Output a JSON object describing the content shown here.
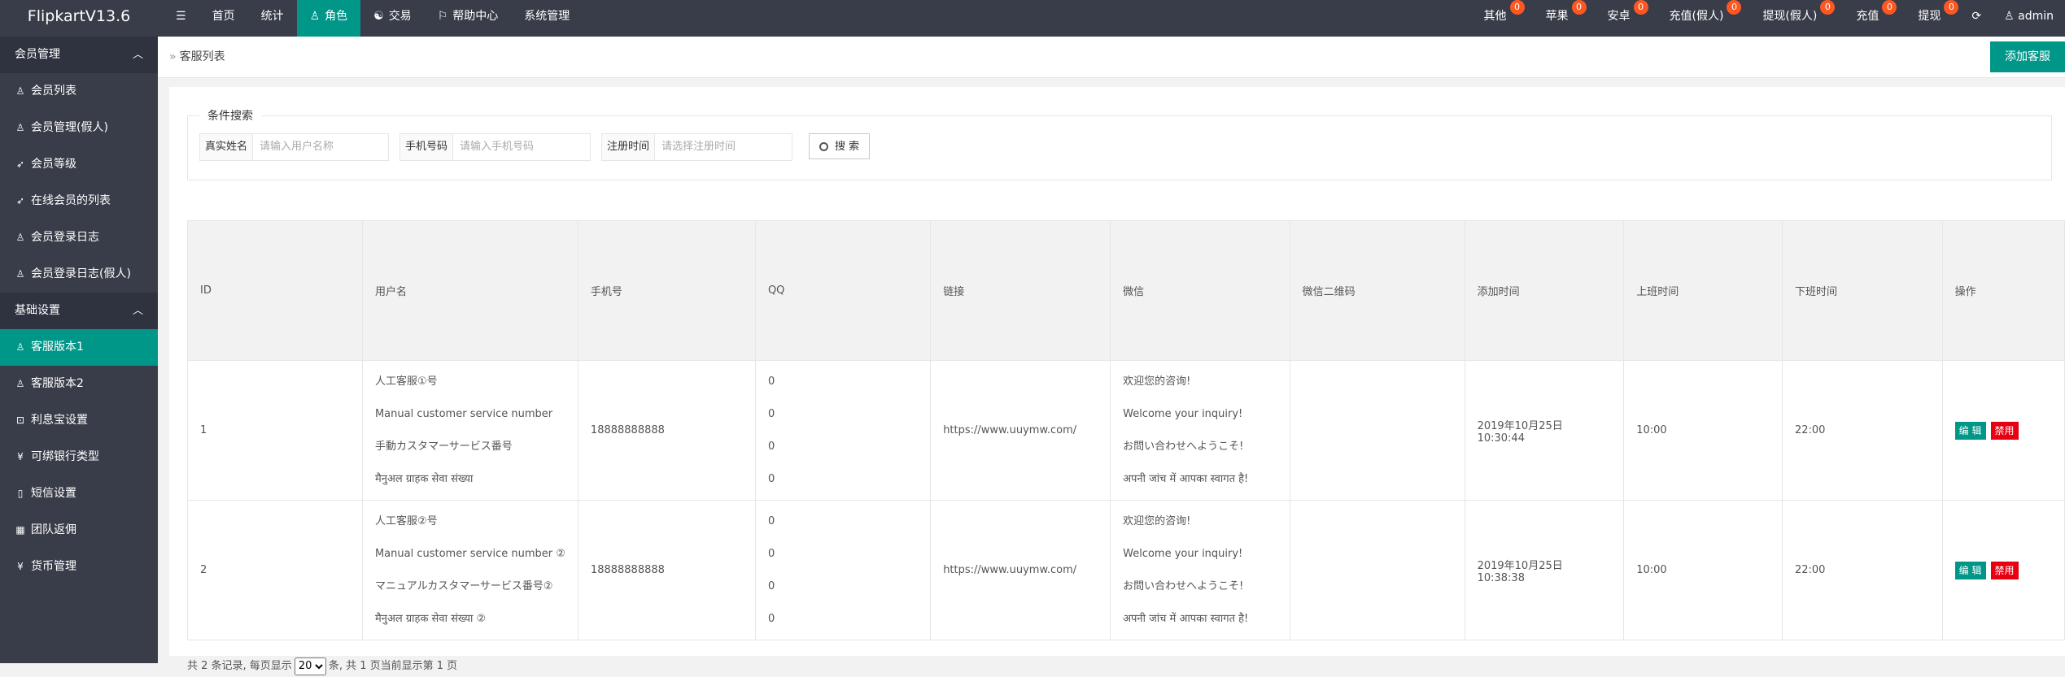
{
  "app": {
    "title": "FlipkartV13.6"
  },
  "topnav": [
    {
      "label": "☰",
      "name": "menu-toggle",
      "icon": ""
    },
    {
      "label": "首页",
      "name": "nav-home",
      "icon": ""
    },
    {
      "label": "统计",
      "name": "nav-stats",
      "icon": ""
    },
    {
      "label": "角色",
      "name": "nav-role",
      "icon": "user-icon",
      "glyph": "♙"
    },
    {
      "label": "交易",
      "name": "nav-trade",
      "icon": "trade-icon",
      "glyph": "☯"
    },
    {
      "label": "帮助中心",
      "name": "nav-help",
      "icon": "flag-icon",
      "glyph": "⚐"
    },
    {
      "label": "系统管理",
      "name": "nav-system",
      "icon": ""
    }
  ],
  "topright": [
    {
      "label": "其他",
      "badge": "0"
    },
    {
      "label": "苹果",
      "badge": "0"
    },
    {
      "label": "安卓",
      "badge": "0"
    },
    {
      "label": "充值(假人)",
      "badge": "0"
    },
    {
      "label": "提现(假人)",
      "badge": "0"
    },
    {
      "label": "充值",
      "badge": "0"
    },
    {
      "label": "提现",
      "badge": "0"
    }
  ],
  "user": {
    "name": "admin"
  },
  "sidebar": {
    "groups": [
      {
        "label": "会员管理",
        "items": [
          {
            "label": "会员列表",
            "icon": "user-icon",
            "glyph": "♙"
          },
          {
            "label": "会员管理(假人)",
            "icon": "user-icon",
            "glyph": "♙"
          },
          {
            "label": "会员等级",
            "icon": "rocket-icon",
            "glyph": "➶"
          },
          {
            "label": "在线会员的列表",
            "icon": "rocket-icon",
            "glyph": "➶"
          },
          {
            "label": "会员登录日志",
            "icon": "user-icon",
            "glyph": "♙"
          },
          {
            "label": "会员登录日志(假人)",
            "icon": "user-icon",
            "glyph": "♙"
          }
        ]
      },
      {
        "label": "基础设置",
        "items": [
          {
            "label": "客服版本1",
            "icon": "user-icon",
            "glyph": "♙",
            "active": true
          },
          {
            "label": "客服版本2",
            "icon": "user-icon",
            "glyph": "♙"
          },
          {
            "label": "利息宝设置",
            "icon": "lock-icon",
            "glyph": "⊡"
          },
          {
            "label": "可绑银行类型",
            "icon": "yen-icon",
            "glyph": "¥"
          },
          {
            "label": "短信设置",
            "icon": "phone-icon",
            "glyph": "▯"
          },
          {
            "label": "团队返佣",
            "icon": "grid-icon",
            "glyph": "▦"
          },
          {
            "label": "货币管理",
            "icon": "yen-icon",
            "glyph": "¥"
          }
        ]
      }
    ]
  },
  "breadcrumb": {
    "label": "客服列表"
  },
  "add_button": {
    "label": "添加客服"
  },
  "search": {
    "legend": "条件搜索",
    "fields": [
      {
        "label": "真实姓名",
        "placeholder": "请输入用户名称"
      },
      {
        "label": "手机号码",
        "placeholder": "请输入手机号码"
      },
      {
        "label": "注册时间",
        "placeholder": "请选择注册时间"
      }
    ],
    "button": "搜 索"
  },
  "table": {
    "headers": [
      "ID",
      "用户名",
      "手机号",
      "QQ",
      "链接",
      "微信",
      "微信二维码",
      "添加时间",
      "上班时间",
      "下班时间",
      "操作"
    ],
    "rows": [
      {
        "id": "1",
        "names": [
          "人工客服①号",
          "Manual customer service number",
          "手動カスタマーサービス番号",
          "मैनुअल ग्राहक सेवा संख्या"
        ],
        "phone": "18888888888",
        "qq": [
          "0",
          "0",
          "0",
          "0"
        ],
        "link": "https://www.uuymw.com/",
        "wechat": [
          "欢迎您的咨询!",
          "Welcome your inquiry!",
          "お問い合わせへようこそ!",
          "अपनी जांच में आपका स्वागत है!"
        ],
        "qrcode": "",
        "added": "2019年10月25日 10:30:44",
        "on": "10:00",
        "off": "22:00",
        "edit": "编 辑",
        "disable": "禁用"
      },
      {
        "id": "2",
        "names": [
          "人工客服②号",
          "Manual customer service number ②",
          "マニュアルカスタマーサービス番号②",
          "मैनुअल ग्राहक सेवा संख्या ②"
        ],
        "phone": "18888888888",
        "qq": [
          "0",
          "0",
          "0",
          "0"
        ],
        "link": "https://www.uuymw.com/",
        "wechat": [
          "欢迎您的咨询!",
          "Welcome your inquiry!",
          "お問い合わせへようこそ!",
          "अपनी जांच में आपका स्वागत है!"
        ],
        "qrcode": "",
        "added": "2019年10月25日 10:38:38",
        "on": "10:00",
        "off": "22:00",
        "edit": "编 辑",
        "disable": "禁用"
      }
    ]
  },
  "pager": {
    "prefix": "共 2 条记录, 每页显示",
    "per_page": "20",
    "suffix": "条, 共 1 页当前显示第 1 页"
  }
}
